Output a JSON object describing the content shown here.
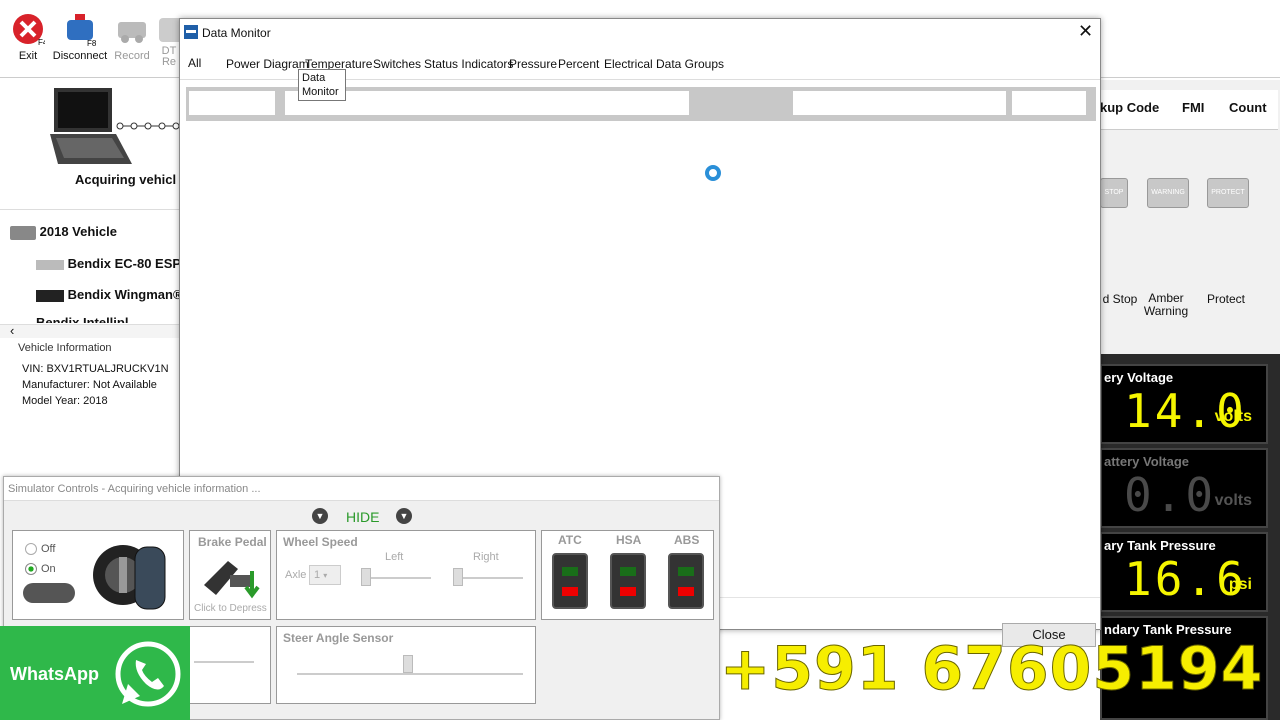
{
  "toolbar": {
    "exit": {
      "label": "Exit",
      "key": "F4"
    },
    "disconnect": {
      "label": "Disconnect",
      "key": "F8"
    },
    "record": {
      "label": "Record"
    },
    "dt": {
      "label1": "DT",
      "label2": "Re"
    }
  },
  "left": {
    "status": "Acquiring vehicl",
    "tree": [
      {
        "label": "2018  Vehicle"
      },
      {
        "label": "Bendix EC-80 ESP"
      },
      {
        "label": "Bendix Wingman®"
      },
      {
        "label": "Bendix Intellipl"
      }
    ],
    "vehicle_info": {
      "title": "Vehicle Information",
      "vin": "VIN: BXV1RTUALJRUCKV1N",
      "manufacturer": "Manufacturer: Not Available",
      "model_year": "Model Year: 2018"
    }
  },
  "right": {
    "columns": [
      "kup Code",
      "FMI",
      "Count"
    ],
    "lamps": [
      {
        "label": "d Stop",
        "icon": "STOP"
      },
      {
        "label": "Amber Warning",
        "icon": "WARNING"
      },
      {
        "label": "Protect",
        "icon": "PROTECT"
      }
    ],
    "gauges": [
      {
        "title": "ery Voltage",
        "value": "14.0",
        "unit": "volts",
        "color": "#f5f500"
      },
      {
        "title": "attery Voltage",
        "value": "0.0",
        "unit": "volts",
        "color": "#3c3c3c"
      },
      {
        "title": "ary Tank Pressure",
        "value": "16.6",
        "unit": "psi",
        "color": "#f5f500"
      },
      {
        "title": "ndary Tank Pressure",
        "value": "",
        "unit": "",
        "color": "#f5f500"
      }
    ]
  },
  "data_monitor": {
    "title": "Data Monitor",
    "tabs": [
      "All",
      "Power Diagram",
      "Temperature",
      "Switches",
      "Status Indicators",
      "Pressure",
      "Percent",
      "Electrical",
      "Data Groups"
    ],
    "tooltip": "Data Monitor",
    "close_label": "Close"
  },
  "simulator": {
    "title": "Simulator Controls - Acquiring vehicle information ...",
    "hide_label": "HIDE",
    "ignition": {
      "off": "Off",
      "on": "On"
    },
    "brake": {
      "title": "Brake Pedal",
      "hint": "Click to Depress"
    },
    "wheel_speed": {
      "title": "Wheel Speed",
      "left": "Left",
      "right": "Right",
      "axle_label": "Axle",
      "axle_value": "1"
    },
    "switches": [
      "ATC",
      "HSA",
      "ABS"
    ],
    "steer": {
      "title": "Steer Angle Sensor"
    }
  },
  "overlay": {
    "whatsapp": "WhatsApp",
    "phone": "+591 67605194"
  },
  "colors": {
    "whatsapp_green": "#2fb84a",
    "phone_yellow": "#f6ee00",
    "accent_blue": "#2a8fd8"
  }
}
